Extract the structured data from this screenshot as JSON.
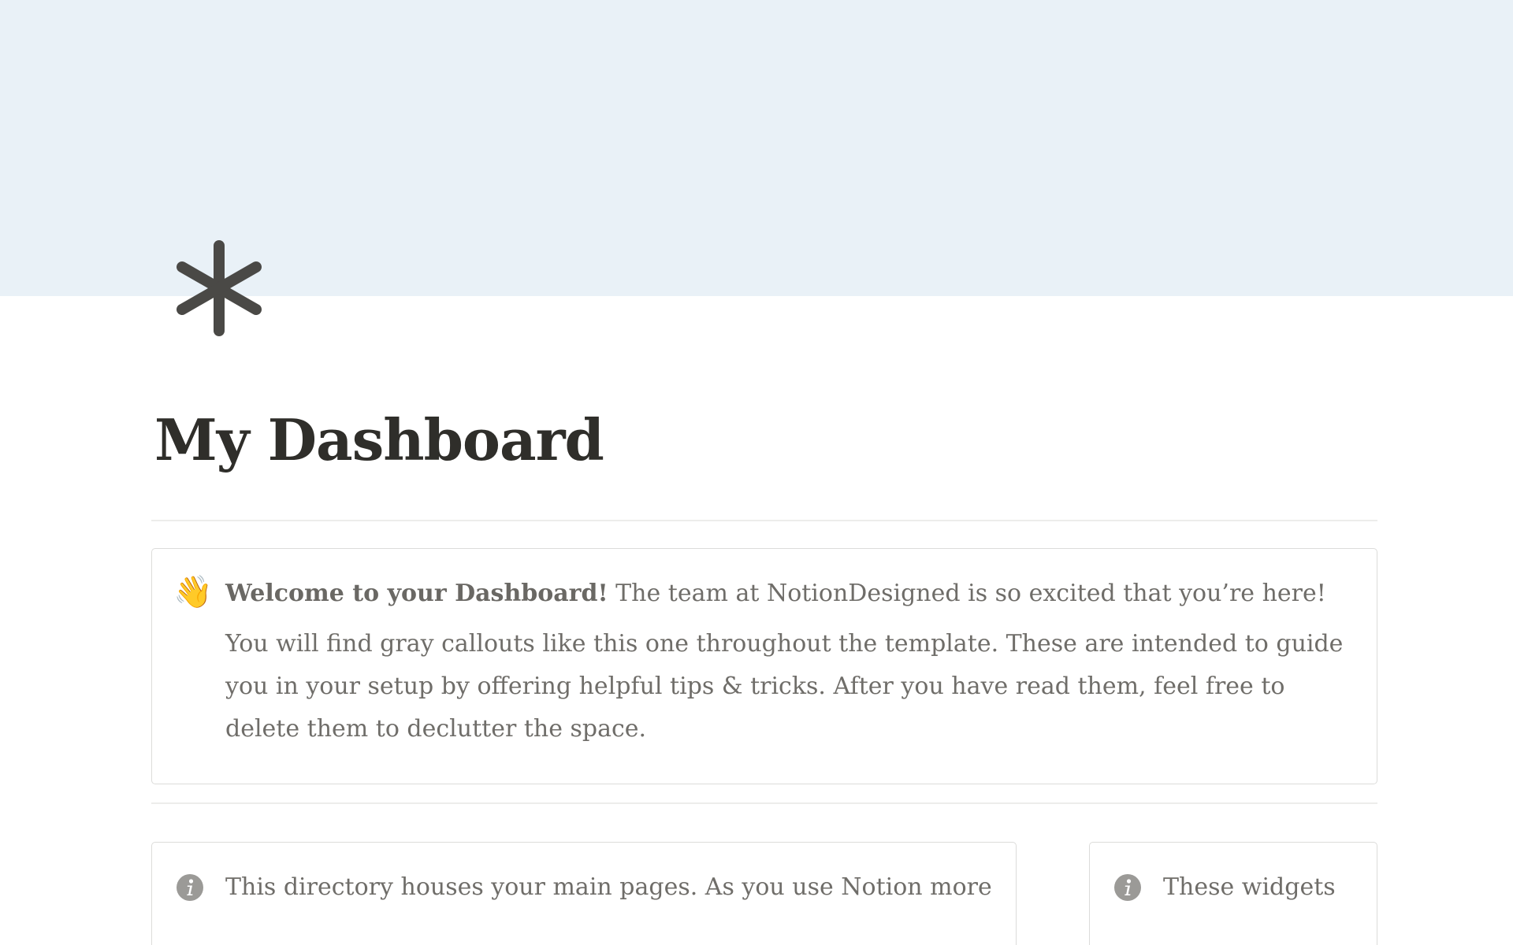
{
  "cover": {
    "color": "#e9f1f7"
  },
  "page": {
    "icon": "asterisk-icon",
    "title": "My Dashboard"
  },
  "welcome_callout": {
    "icon": "waving-hand-emoji",
    "emoji": "👋",
    "heading": "Welcome to your Dashboard!",
    "intro": " The team at NotionDesigned is so excited that you’re here!",
    "body": "You will find gray callouts like this one throughout the template. These are  intended to guide you in your setup by offering helpful tips & tricks. After you have read them, feel free to delete them to declutter the space."
  },
  "directory_callout": {
    "icon": "info-icon",
    "text": "This directory houses your main pages. As you use Notion more"
  },
  "widgets_callout": {
    "icon": "info-icon",
    "text": "These widgets"
  }
}
